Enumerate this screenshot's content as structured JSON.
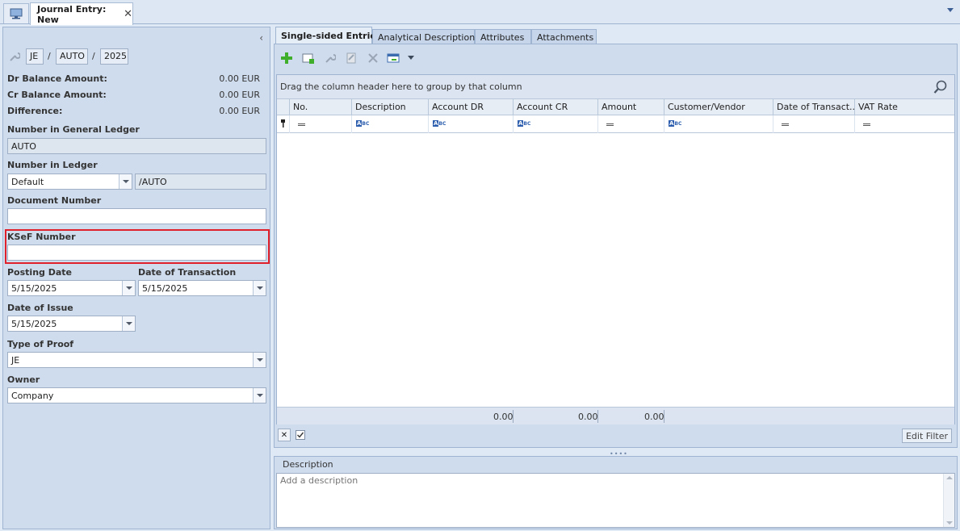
{
  "top_tab": {
    "title": "Journal Entry: New",
    "close": "✕"
  },
  "left": {
    "collapse": "‹",
    "number": {
      "prefix": "JE",
      "mid": "AUTO",
      "year": "2025",
      "sep": "/"
    },
    "dr_label": "Dr Balance Amount:",
    "dr_value": "0.00 EUR",
    "cr_label": "Cr Balance Amount:",
    "cr_value": "0.00 EUR",
    "diff_label": "Difference:",
    "diff_value": "0.00 EUR",
    "gl_label": "Number in General Ledger",
    "gl_value": "AUTO",
    "ledger_label": "Number in Ledger",
    "ledger_value": "Default",
    "ledger_suffix": "/AUTO",
    "docnum_label": "Document Number",
    "docnum_value": "",
    "ksef_label": "KSeF Number",
    "ksef_value": "",
    "posting_label": "Posting Date",
    "posting_value": "5/15/2025",
    "transaction_label": "Date of Transaction",
    "transaction_value": "5/15/2025",
    "issue_label": "Date of Issue",
    "issue_value": "5/15/2025",
    "proof_label": "Type of Proof",
    "proof_value": "JE",
    "owner_label": "Owner",
    "owner_value": "Company"
  },
  "tabs": [
    "Single-sided Entries",
    "Analytical Description",
    "Attributes",
    "Attachments"
  ],
  "grid": {
    "group_hint": "Drag the column header here to group by that column",
    "columns": [
      "No.",
      "Description",
      "Account DR",
      "Account CR",
      "Amount",
      "Customer/Vendor",
      "Date of Transact...",
      "VAT Rate"
    ],
    "totals": [
      "0.00",
      "0.00",
      "0.00"
    ],
    "edit_filter": "Edit Filter"
  },
  "description": {
    "title": "Description",
    "placeholder": "Add a description"
  }
}
